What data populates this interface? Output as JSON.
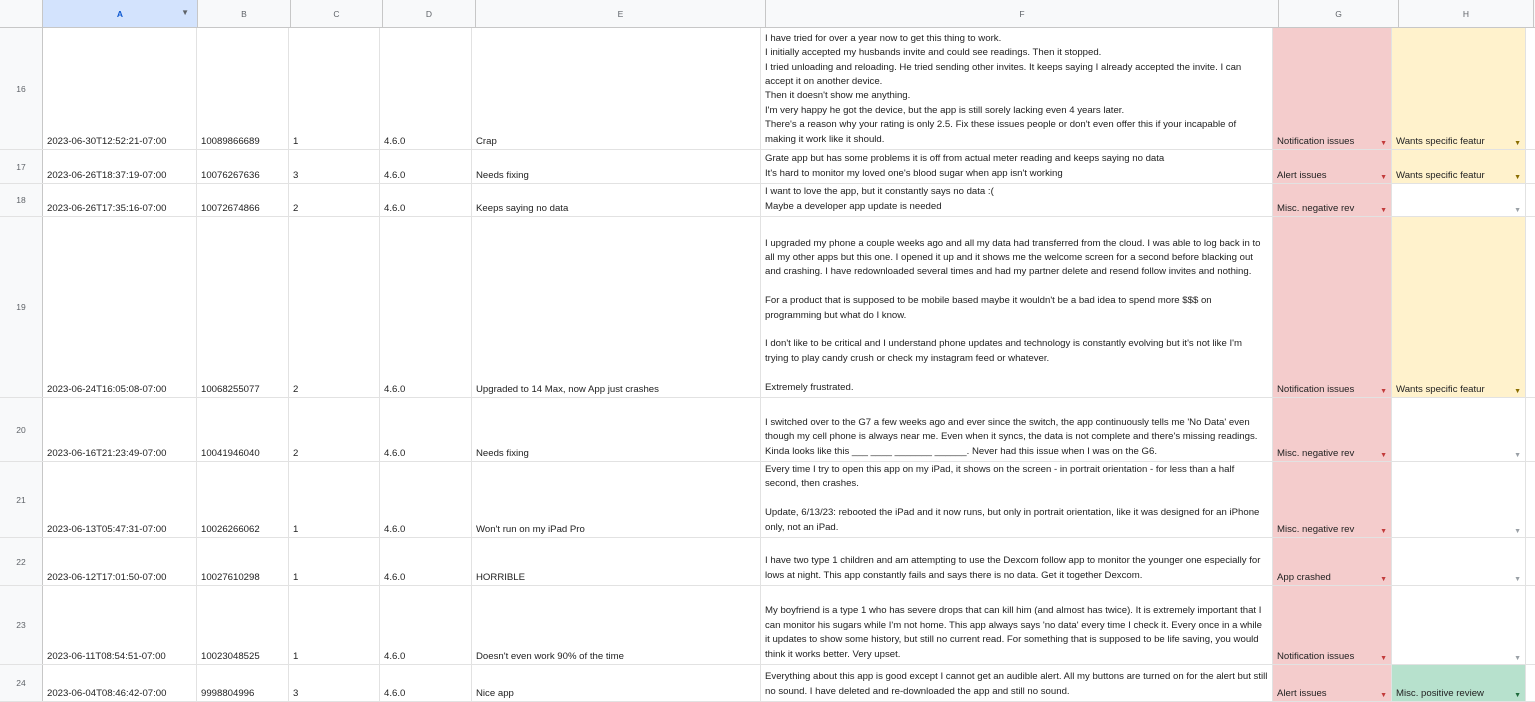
{
  "columns": [
    "A",
    "B",
    "C",
    "D",
    "E",
    "F",
    "G",
    "H"
  ],
  "rows": [
    {
      "num": "16",
      "a": "2023-06-30T12:52:21-07:00",
      "b": "10089866689",
      "c": "1",
      "d": "4.6.0",
      "e": "Crap",
      "f": "I have tried for over a year now to get this thing to work.\nI initially accepted my husbands invite and could see readings. Then it stopped.\nI tried unloading and reloading. He tried sending other invites. It keeps saying I already accepted the invite. I can accept it on another device.\nThen it doesn't show me anything.\nI'm very happy he got the device, but the app is still sorely lacking even 4 years later.\nThere's a reason why your rating is only 2.5. Fix these issues people or don't even offer this if your incapable of making it work like it should.",
      "g": "Notification issues",
      "h": "Wants specific featur"
    },
    {
      "num": "17",
      "a": "2023-06-26T18:37:19-07:00",
      "b": "10076267636",
      "c": "3",
      "d": "4.6.0",
      "e": "Needs fixing",
      "f": "Grate app but has some problems it is off from actual meter reading and keeps saying no data\nIt's hard to monitor my loved one's blood sugar when app isn't working",
      "g": "Alert issues",
      "h": "Wants specific featur"
    },
    {
      "num": "18",
      "a": "2023-06-26T17:35:16-07:00",
      "b": "10072674866",
      "c": "2",
      "d": "4.6.0",
      "e": "Keeps saying no data",
      "f": "I want to love the app, but it constantly says no data :(\nMaybe a developer app update is needed",
      "g": "Misc. negative rev",
      "h": ""
    },
    {
      "num": "19",
      "a": "2023-06-24T16:05:08-07:00",
      "b": "10068255077",
      "c": "2",
      "d": "4.6.0",
      "e": "Upgraded to 14 Max, now App just crashes",
      "f": "I upgraded my phone a couple weeks ago and all my data had transferred from the cloud. I was able to log back in to all my other apps but this one. I opened it up and it shows me the welcome screen for a second before blacking out and crashing. I have redownloaded several times and had my partner delete and resend follow invites and nothing.\n\nFor a product that is supposed to be mobile based maybe it wouldn't be a bad idea to spend more $$$ on programming but what do I know.\n\nI don't like to be critical and I understand phone updates and technology is constantly evolving but it's not like I'm trying to play candy crush or check my instagram feed or whatever.\n\nExtremely frustrated.",
      "g": "Notification issues",
      "h": "Wants specific featur"
    },
    {
      "num": "20",
      "a": "2023-06-16T21:23:49-07:00",
      "b": "10041946040",
      "c": "2",
      "d": "4.6.0",
      "e": "Needs fixing",
      "f": "I switched over to the G7 a few weeks ago and ever since the switch, the app continuously tells me 'No Data' even though my cell phone is always near me. Even when it syncs, the data is not complete and there's missing readings. Kinda looks like this ___ ____ _______ ______. Never had this issue when I was on the G6.",
      "g": "Misc. negative rev",
      "h": ""
    },
    {
      "num": "21",
      "a": "2023-06-13T05:47:31-07:00",
      "b": "10026266062",
      "c": "1",
      "d": "4.6.0",
      "e": "Won't run on my iPad Pro",
      "f": "Every time I try to open this app on my iPad, it shows on the screen - in portrait orientation - for less than a half second, then crashes.\n\nUpdate, 6/13/23: rebooted the iPad and it now runs, but only in portrait orientation, like it was designed for an iPhone only, not an iPad.",
      "g": "Misc. negative rev",
      "h": ""
    },
    {
      "num": "22",
      "a": "2023-06-12T17:01:50-07:00",
      "b": "10027610298",
      "c": "1",
      "d": "4.6.0",
      "e": "HORRIBLE",
      "f": "I have two type 1 children and am attempting to use the Dexcom follow app to monitor the younger one especially for lows at night. This app constantly fails and says there is no data. Get it together Dexcom.",
      "g": "App crashed",
      "h": ""
    },
    {
      "num": "23",
      "a": "2023-06-11T08:54:51-07:00",
      "b": "10023048525",
      "c": "1",
      "d": "4.6.0",
      "e": "Doesn't even work 90% of the time",
      "f": "My boyfriend is a type 1 who has severe drops that can kill him (and almost has twice). It is extremely important that I can monitor his sugars while I'm not home. This app always says 'no data' every time I check it. Every once in a while it updates to show some history, but still no current read. For something that is supposed to be life saving, you would think it works better. Very upset.",
      "g": "Notification issues",
      "h": ""
    },
    {
      "num": "24",
      "a": "2023-06-04T08:46:42-07:00",
      "b": "9998804996",
      "c": "3",
      "d": "4.6.0",
      "e": "Nice app",
      "f": "Everything about this app is good except I cannot get an audible alert. All my buttons are turned on for the alert but still no sound. I have deleted and re-downloaded the app and still no sound.",
      "g": "Alert issues",
      "h": "Misc. positive review"
    }
  ]
}
